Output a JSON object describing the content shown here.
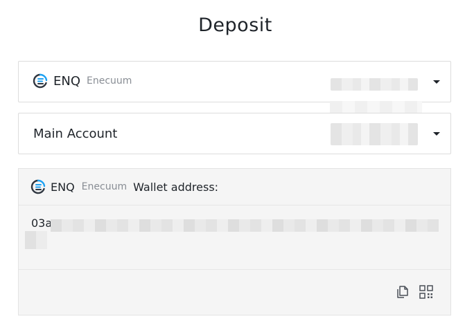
{
  "page": {
    "title": "Deposit"
  },
  "coin_select": {
    "code": "ENQ",
    "name": "Enecuum",
    "icon": "enecuum-logo-icon"
  },
  "account_select": {
    "label": "Main Account"
  },
  "wallet": {
    "code": "ENQ",
    "name": "Enecuum",
    "label": "Wallet address:",
    "address_prefix": "03a",
    "actions": [
      "copy-icon",
      "qr-code-icon"
    ]
  },
  "colors": {
    "accent": "#1da1f2",
    "logo_dark": "#2f3640",
    "text": "#1e2329",
    "muted": "#888d94"
  }
}
